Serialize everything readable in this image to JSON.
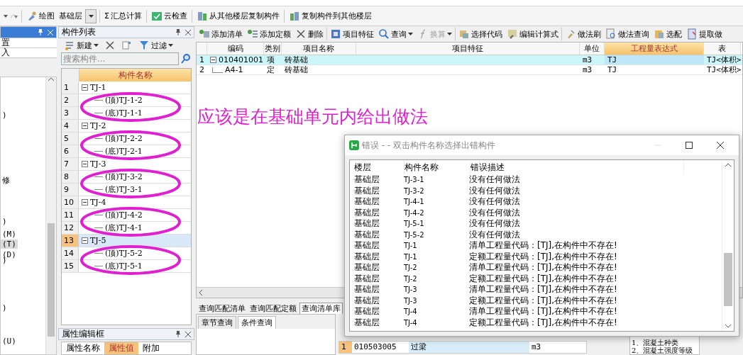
{
  "top_toolbar": {
    "items": [
      {
        "kind": "button",
        "label": "绘图"
      },
      {
        "kind": "select",
        "label": "基础层"
      },
      {
        "kind": "button",
        "symbol": "Σ",
        "label": "汇总计算"
      },
      {
        "kind": "button",
        "label": "云检查"
      },
      {
        "kind": "button",
        "label": "从其他楼层复制构件"
      },
      {
        "kind": "button",
        "label": "复制构件到其他楼层"
      }
    ]
  },
  "left_panel": {
    "items": [
      "置",
      "入"
    ],
    "fragments": [
      {
        "text": ")",
        "selected": false
      },
      {
        "text": "修",
        "selected": false
      },
      {
        "text": ")",
        "selected": false
      },
      {
        "text": "(M)",
        "selected": false
      },
      {
        "text": "(T)",
        "selected": true
      },
      {
        "text": "(D)",
        "selected": false
      },
      {
        "text": ")",
        "selected": false
      },
      {
        "text": ")",
        "selected": false
      },
      {
        "text": "(U)",
        "selected": false
      }
    ]
  },
  "component_list": {
    "title": "构件列表",
    "toolbar": [
      {
        "label": "新建",
        "kind": "dropdown"
      },
      {
        "kind": "delete"
      },
      {
        "kind": "copy"
      },
      {
        "label": "过滤",
        "kind": "filter"
      }
    ],
    "search": {
      "placeholder": "搜索构件..."
    },
    "column": "构件名称",
    "tree": [
      {
        "index": "1",
        "name": "TJ-1",
        "expanded": true,
        "selected": false,
        "children": [
          {
            "index": "2",
            "name": "(顶)TJ-1-2",
            "selected": false
          },
          {
            "index": "3",
            "name": "(底)TJ-1-1",
            "selected": false
          }
        ]
      },
      {
        "index": "4",
        "name": "TJ-2",
        "expanded": true,
        "selected": false,
        "children": [
          {
            "index": "5",
            "name": "(顶)TJ-2-2",
            "selected": false
          },
          {
            "index": "6",
            "name": "(底)TJ-2-1",
            "selected": false
          }
        ]
      },
      {
        "index": "7",
        "name": "TJ-3",
        "expanded": true,
        "selected": false,
        "children": [
          {
            "index": "8",
            "name": "(顶)TJ-3-2",
            "selected": false
          },
          {
            "index": "9",
            "name": "(底)TJ-3-1",
            "selected": false
          }
        ]
      },
      {
        "index": "10",
        "name": "TJ-4",
        "expanded": true,
        "selected": false,
        "children": [
          {
            "index": "11",
            "name": "(顶)TJ-4-2",
            "selected": false
          },
          {
            "index": "12",
            "name": "(底)TJ-4-1",
            "selected": false
          }
        ]
      },
      {
        "index": "13",
        "name": "TJ-5",
        "expanded": true,
        "selected": true,
        "children": [
          {
            "index": "14",
            "name": "(顶)TJ-5-2",
            "selected": false
          },
          {
            "index": "15",
            "name": "(底)TJ-5-1",
            "selected": false
          }
        ]
      }
    ]
  },
  "property_panel": {
    "title": "属性编辑框",
    "columns": [
      "属性名称",
      "属性值",
      "附加"
    ]
  },
  "method_toolbar": [
    {
      "label": "添加清单",
      "dropdown": false,
      "disabled": false
    },
    {
      "label": "添加定额",
      "dropdown": false,
      "disabled": false
    },
    {
      "label": "删除",
      "dropdown": false,
      "disabled": false
    },
    {
      "label": "项目特征",
      "dropdown": false,
      "disabled": false
    },
    {
      "label": "查询",
      "dropdown": true,
      "disabled": false
    },
    {
      "label": "换算",
      "dropdown": true,
      "disabled": true
    },
    {
      "label": "选择代码",
      "dropdown": false,
      "disabled": false
    },
    {
      "label": "编辑计算式",
      "dropdown": false,
      "disabled": false
    },
    {
      "label": "做法刷",
      "dropdown": false,
      "disabled": false
    },
    {
      "label": "做法查询",
      "dropdown": false,
      "disabled": false
    },
    {
      "label": "选配",
      "dropdown": false,
      "disabled": false
    },
    {
      "label": "提取做",
      "dropdown": false,
      "disabled": false
    }
  ],
  "method_table": {
    "columns": [
      {
        "label": "编码",
        "selected": false
      },
      {
        "label": "类别",
        "selected": false
      },
      {
        "label": "项目名称",
        "selected": false
      },
      {
        "label": "项目特征",
        "selected": false
      },
      {
        "label": "单位",
        "selected": false
      },
      {
        "label": "工程量表达式",
        "selected": true
      },
      {
        "label": "表",
        "selected": false
      }
    ],
    "rows": [
      {
        "index": "1",
        "kind": "list",
        "selected": true,
        "cells": [
          "010401001",
          "项",
          "砖基础",
          "",
          "m3",
          "TJ",
          "TJ<体积>"
        ]
      },
      {
        "index": "2",
        "kind": "quota",
        "selected": false,
        "cells": [
          "A4-1",
          "定",
          "砖基础",
          "",
          "m3",
          "TJ",
          "TJ<体积>"
        ]
      }
    ]
  },
  "annotation": {
    "text": "应该是在基础单元内给出做法"
  },
  "query_panel": {
    "tabs": [
      {
        "label": "查询匹配清单",
        "selected": false
      },
      {
        "label": "查询匹配定额",
        "selected": false
      },
      {
        "label": "查询清单库",
        "selected": true
      }
    ],
    "subtabs": [
      {
        "label": "章节查询",
        "selected": false
      },
      {
        "label": "条件查询",
        "selected": true
      }
    ],
    "rows": [
      {
        "index": "1",
        "code": "010503005",
        "name": "过梁",
        "unit": "m3"
      }
    ],
    "features": [
      "1、混凝土种类",
      "2、混凝土强度等级"
    ]
  },
  "error_dialog": {
    "title": "错误 - - 双击构件名称选择出错构件",
    "columns": [
      "楼层",
      "构件名称",
      "错误描述"
    ],
    "rows": [
      [
        "基础层",
        "TJ-3-1",
        "没有任何做法"
      ],
      [
        "基础层",
        "TJ-3-2",
        "没有任何做法"
      ],
      [
        "基础层",
        "TJ-4-1",
        "没有任何做法"
      ],
      [
        "基础层",
        "TJ-4-2",
        "没有任何做法"
      ],
      [
        "基础层",
        "TJ-5-1",
        "没有任何做法"
      ],
      [
        "基础层",
        "TJ-5-2",
        "没有任何做法"
      ],
      [
        "基础层",
        "TJ-1",
        "清单工程量代码：[TJ],在构件中不存在!"
      ],
      [
        "基础层",
        "TJ-1",
        "定额工程量代码：[TJ],在构件中不存在!"
      ],
      [
        "基础层",
        "TJ-2",
        "清单工程量代码：[TJ],在构件中不存在!"
      ],
      [
        "基础层",
        "TJ-2",
        "定额工程量代码：[TJ],在构件中不存在!"
      ],
      [
        "基础层",
        "TJ-3",
        "清单工程量代码：[TJ],在构件中不存在!"
      ],
      [
        "基础层",
        "TJ-3",
        "定额工程量代码：[TJ],在构件中不存在!"
      ],
      [
        "基础层",
        "TJ-4",
        "清单工程量代码：[TJ],在构件中不存在!"
      ],
      [
        "基础层",
        "TJ-4",
        "定额工程量代码：[TJ],在构件中不存在!"
      ]
    ]
  }
}
